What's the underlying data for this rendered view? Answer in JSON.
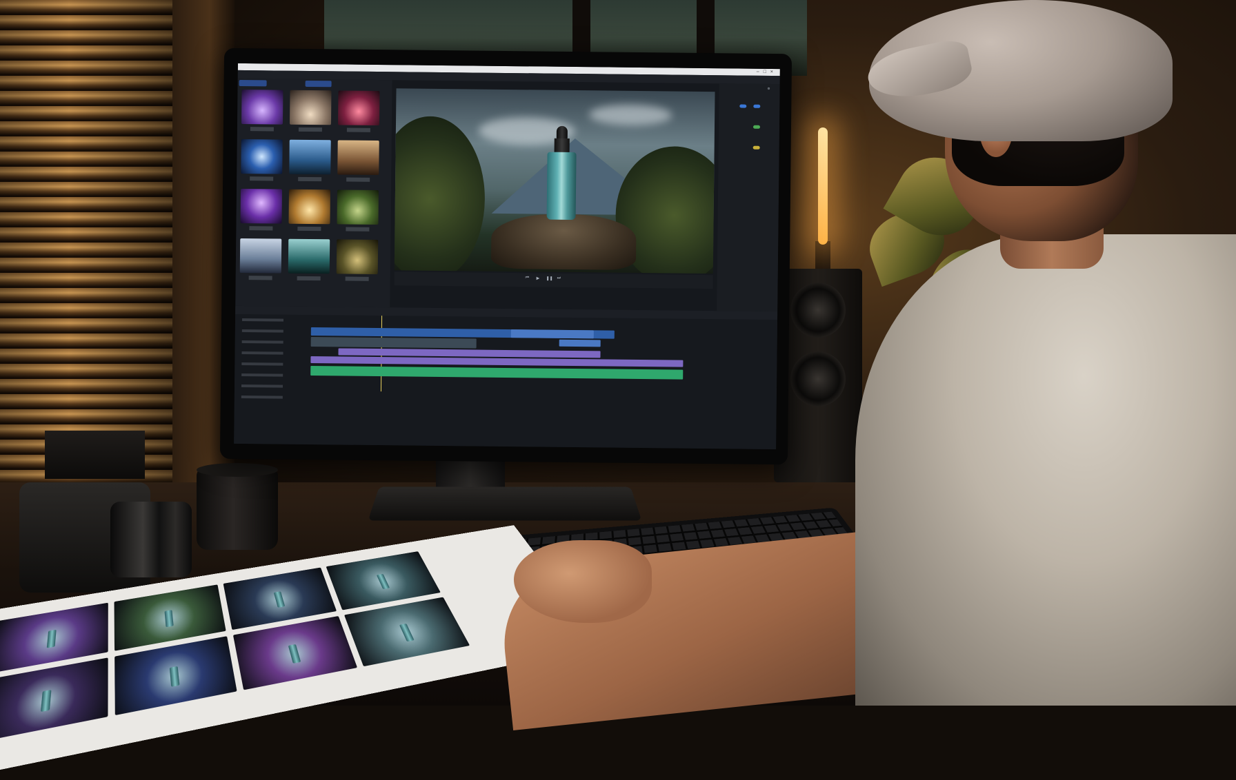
{
  "palette": {
    "accent": "#2b4b8c",
    "timeline_video": "#2f5fa8",
    "timeline_purple": "#7d68c2",
    "timeline_audio": "#2fa86d",
    "playhead": "#e9d25f"
  },
  "editor": {
    "media_thumbnails": [
      {
        "theme": "purple-nebula"
      },
      {
        "theme": "dusk-mountain"
      },
      {
        "theme": "red-glow"
      },
      {
        "theme": "blue-lightburst"
      },
      {
        "theme": "blue-mountain"
      },
      {
        "theme": "warm-mountain"
      },
      {
        "theme": "violet-storm"
      },
      {
        "theme": "golden-desert"
      },
      {
        "theme": "jungle-green"
      },
      {
        "theme": "sky-cloud"
      },
      {
        "theme": "teal-forest"
      },
      {
        "theme": "olive-forest"
      }
    ],
    "preview_subject": "dropper-bottle-on-rock",
    "track_count": 8
  },
  "icons": [
    "play-icon",
    "pause-icon",
    "skip-back-icon",
    "skip-forward-icon",
    "settings-icon",
    "close-icon",
    "minimize-icon",
    "maximize-icon"
  ]
}
